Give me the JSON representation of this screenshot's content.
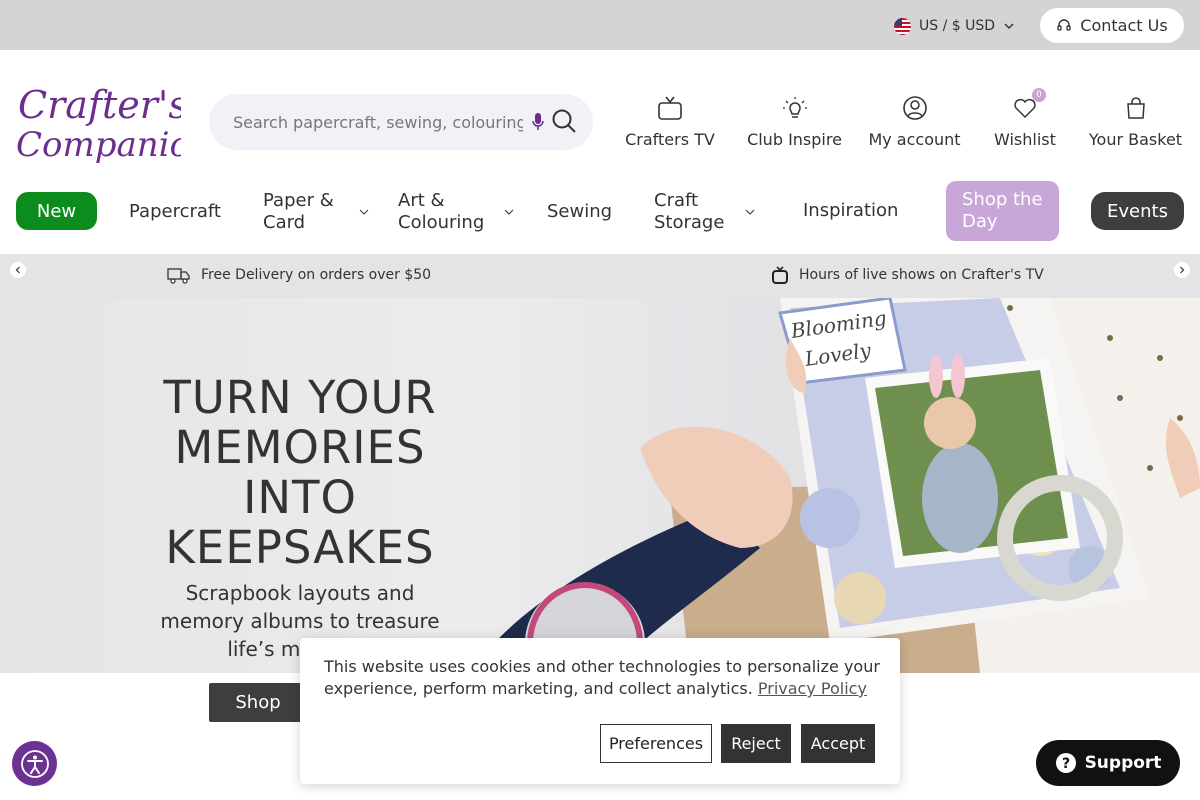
{
  "topbar": {
    "region_label": "US / $ USD",
    "contact_label": "Contact Us"
  },
  "header": {
    "logo_line1": "Crafter's",
    "logo_line2": "Companion",
    "search_placeholder": "Search papercraft, sewing, colouring",
    "icons": {
      "tv_label": "Crafters TV",
      "inspire_label": "Club Inspire",
      "account_label": "My account",
      "wishlist_label": "Wishlist",
      "wishlist_count": "0",
      "basket_label": "Your Basket"
    }
  },
  "nav": {
    "new": "New",
    "papercraft": "Papercraft",
    "paper_card": "Paper & Card",
    "art_colouring": "Art & Colouring",
    "sewing": "Sewing",
    "craft_storage": "Craft Storage",
    "inspiration": "Inspiration",
    "shop_day": "Shop the Day",
    "events": "Events"
  },
  "promo": {
    "delivery": "Free Delivery on orders over $50",
    "live": "Hours of live shows on Crafter's TV"
  },
  "hero": {
    "title": "TURN YOUR MEMORIES INTO KEEPSAKES",
    "subtitle": "Scrapbook layouts and memory albums to treasure life’s most spe",
    "button": "Shop",
    "card_text_1": "Blooming",
    "card_text_2": "Lovely"
  },
  "cookie": {
    "text": "This website uses cookies and other technologies to personalize your experience, perform marketing, and collect analytics.",
    "privacy_link": "Privacy Policy",
    "preferences": "Preferences",
    "reject": "Reject",
    "accept": "Accept"
  },
  "support": {
    "label": "Support"
  },
  "colors": {
    "brand_purple": "#6b2d8e",
    "new_green": "#0b8c1c",
    "shop_day_lilac": "#c9a6d8",
    "dark": "#3e3e3e"
  }
}
